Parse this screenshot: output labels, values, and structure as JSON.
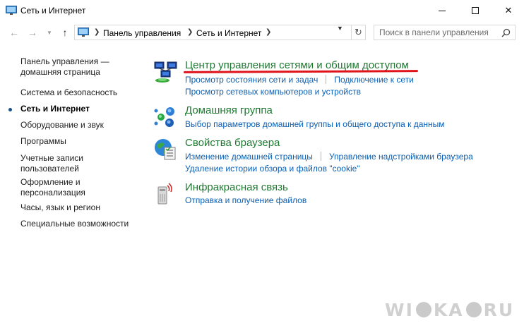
{
  "window": {
    "title": "Сеть и Интернет",
    "minimize_icon": "minimize-icon",
    "maximize_icon": "maximize-icon",
    "close_icon": "close-icon"
  },
  "address": {
    "crumbs": [
      "Панель управления",
      "Сеть и Интернет"
    ],
    "search_placeholder": "Поиск в панели управления"
  },
  "sidebar": {
    "items": [
      {
        "line1": "Панель управления —",
        "line2": "домашняя страница"
      },
      {
        "line1": "Система и безопасность"
      },
      {
        "line1": "Сеть и Интернет",
        "current": true
      },
      {
        "line1": "Оборудование и звук"
      },
      {
        "line1": "Программы"
      },
      {
        "line1": "Учетные записи",
        "line2": "пользователей"
      },
      {
        "line1": "Оформление и",
        "line2": "персонализация"
      },
      {
        "line1": "Часы, язык и регион"
      },
      {
        "line1": "Специальные возможности"
      }
    ]
  },
  "sections": [
    {
      "title": "Центр управления сетями и общим доступом",
      "icon": "network-center-icon",
      "rows": [
        [
          "Просмотр состояния сети и задач",
          "Подключение к сети"
        ],
        [
          "Просмотр сетевых компьютеров и устройств"
        ]
      ]
    },
    {
      "title": "Домашняя группа",
      "icon": "homegroup-icon",
      "rows": [
        [
          "Выбор параметров домашней группы и общего доступа к данным"
        ]
      ]
    },
    {
      "title": "Свойства браузера",
      "icon": "internet-options-icon",
      "rows": [
        [
          "Изменение домашней страницы",
          "Управление надстройками браузера"
        ],
        [
          "Удаление истории обзора и файлов \"cookie\""
        ]
      ]
    },
    {
      "title": "Инфракрасная связь",
      "icon": "infrared-icon",
      "rows": [
        [
          "Отправка и получение файлов"
        ]
      ]
    }
  ],
  "watermark": {
    "left": "WI",
    "mid": "KA",
    "right": "RU"
  },
  "colors": {
    "title_green": "#1e7a31",
    "link_blue": "#0a5fb4",
    "highlight_red": "#e0131b"
  }
}
